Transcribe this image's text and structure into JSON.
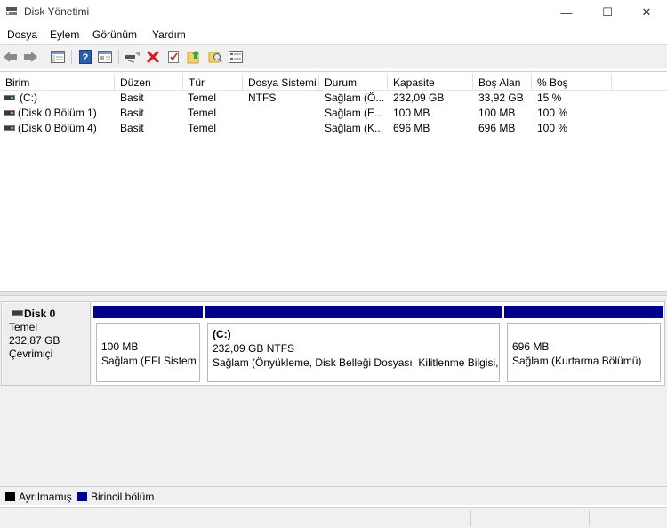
{
  "window": {
    "title": "Disk Yönetimi",
    "minimize": "—",
    "maximize": "☐",
    "close": "✕"
  },
  "menu": [
    "Dosya",
    "Eylem",
    "Görünüm",
    "Yardım"
  ],
  "toolbar": {
    "icons": [
      "back-icon",
      "forward-icon",
      "console-tree-icon",
      "help-icon",
      "properties-icon",
      "connect-icon",
      "delete-icon",
      "check-icon",
      "folder-up-icon",
      "search-folder-icon",
      "settings-list-icon"
    ]
  },
  "list": {
    "columns": [
      "Birim",
      "Düzen",
      "Tür",
      "Dosya Sistemi",
      "Durum",
      "Kapasite",
      "Boş Alan",
      "% Boş"
    ],
    "rows": [
      {
        "birim": "(C:)",
        "duzen": "Basit",
        "tur": "Temel",
        "fs": "NTFS",
        "durum": "Sağlam (Ö...",
        "kapasite": "232,09 GB",
        "bos": "33,92 GB",
        "yuzde": "15 %"
      },
      {
        "birim": "(Disk 0 Bölüm 1)",
        "duzen": "Basit",
        "tur": "Temel",
        "fs": "",
        "durum": "Sağlam (E...",
        "kapasite": "100 MB",
        "bos": "100 MB",
        "yuzde": "100 %"
      },
      {
        "birim": "(Disk 0 Bölüm 4)",
        "duzen": "Basit",
        "tur": "Temel",
        "fs": "",
        "durum": "Sağlam (K...",
        "kapasite": "696 MB",
        "bos": "696 MB",
        "yuzde": "100 %"
      }
    ]
  },
  "disk": {
    "name": "Disk 0",
    "type": "Temel",
    "size": "232,87 GB",
    "status": "Çevrimiçi",
    "partitions": [
      {
        "name": "",
        "size": "100 MB",
        "status": "Sağlam (EFI Sistem B"
      },
      {
        "name": "(C:)",
        "size": "232,09 GB NTFS",
        "status": "Sağlam (Önyükleme, Disk Belleği Dosyası, Kilitlenme Bilgisi, T"
      },
      {
        "name": "",
        "size": "696 MB",
        "status": "Sağlam (Kurtarma Bölümü)"
      }
    ]
  },
  "legend": {
    "unallocated": {
      "label": "Ayrılmamış",
      "color": "#000000"
    },
    "primary": {
      "label": "Birincil bölüm",
      "color": "#00008b"
    }
  },
  "colors": {
    "partition_bar": "#00008b"
  }
}
